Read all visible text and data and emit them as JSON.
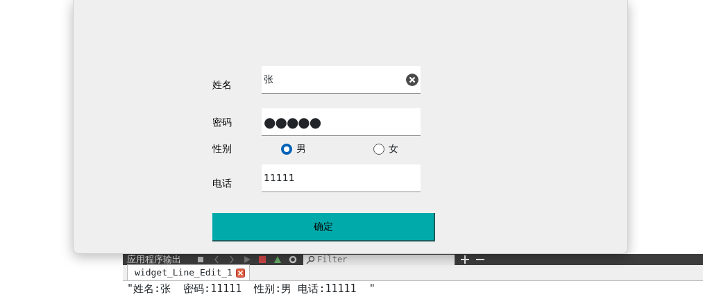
{
  "dialog": {
    "fields": [
      {
        "kind": "text",
        "label": "姓名",
        "value": "张",
        "clear_button": true
      },
      {
        "kind": "password",
        "label": "密码",
        "value": "●●●●●"
      },
      {
        "kind": "radio",
        "label": "性别",
        "options": [
          {
            "label": "男",
            "selected": true
          },
          {
            "label": "女",
            "selected": false
          }
        ]
      },
      {
        "kind": "text",
        "label": "电话",
        "value": "11111"
      }
    ],
    "submit": "确定"
  },
  "output_pane": {
    "title": "应用程序输出",
    "filter": {
      "placeholder": "Filter"
    },
    "tabs": [
      {
        "label": "widget_Line_Edit_1",
        "selected": true
      }
    ],
    "output": "\"姓名:张  密码:11111  性别:男 电话:11111  \""
  }
}
